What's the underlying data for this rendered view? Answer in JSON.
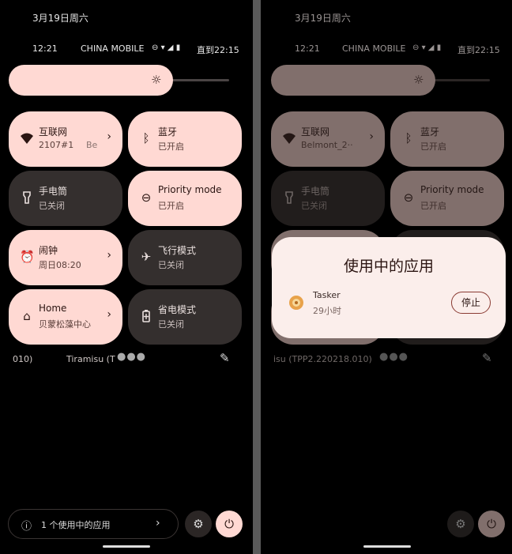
{
  "left": {
    "date": "3月19日周六",
    "time": "12:21",
    "carrier": "CHINA MOBILE",
    "battery_text": "直到22:15",
    "tiles": [
      {
        "title": "互联网",
        "sub": "2107#1",
        "sub_extra": "Be",
        "icon": "wifi-icon",
        "chevron": true
      },
      {
        "title": "蓝牙",
        "sub": "已开启",
        "icon": "bluetooth-icon",
        "chevron": false
      },
      {
        "title": "手电筒",
        "sub": "已关闭",
        "icon": "flashlight-icon",
        "chevron": false
      },
      {
        "title": "Priority mode",
        "sub": "已开启",
        "icon": "priority-mode-icon",
        "chevron": false
      },
      {
        "title": "闹钟",
        "sub": "周日08:20",
        "icon": "alarm-clock-icon",
        "chevron": true
      },
      {
        "title": "飞行模式",
        "sub": "已关闭",
        "icon": "airplane-icon",
        "chevron": false
      },
      {
        "title": "Home",
        "sub": "贝蒙松藻中心",
        "icon": "home-icon",
        "chevron": true
      },
      {
        "title": "省电模式",
        "sub": "已关闭",
        "icon": "battery-saver-icon",
        "chevron": false
      }
    ],
    "build_left": "010)",
    "build_text": "Tiramisu (T",
    "active_apps": "1 个使用中的应用"
  },
  "right": {
    "date": "3月19日周六",
    "time": "12:21",
    "carrier": "CHINA MOBILE",
    "battery_text": "直到22:15",
    "tiles": [
      {
        "title": "互联网",
        "sub": "Belmont_2··"
      },
      {
        "title": "蓝牙",
        "sub": "已开启"
      },
      {
        "title": "手电筒",
        "sub": "已关闭"
      },
      {
        "title": "Priority mode",
        "sub": "已开启"
      }
    ],
    "build_text": "isu (TPP2.220218.010)",
    "dialog": {
      "title": "使用中的应用",
      "app_name": "Tasker",
      "app_duration": "29小时",
      "stop_label": "停止"
    }
  },
  "colors": {
    "tile_on": "#ffd9d3",
    "tile_off": "#342f2e",
    "background": "#000000",
    "dialog": "#fbeeeb",
    "stop_border": "#8a3b33"
  }
}
